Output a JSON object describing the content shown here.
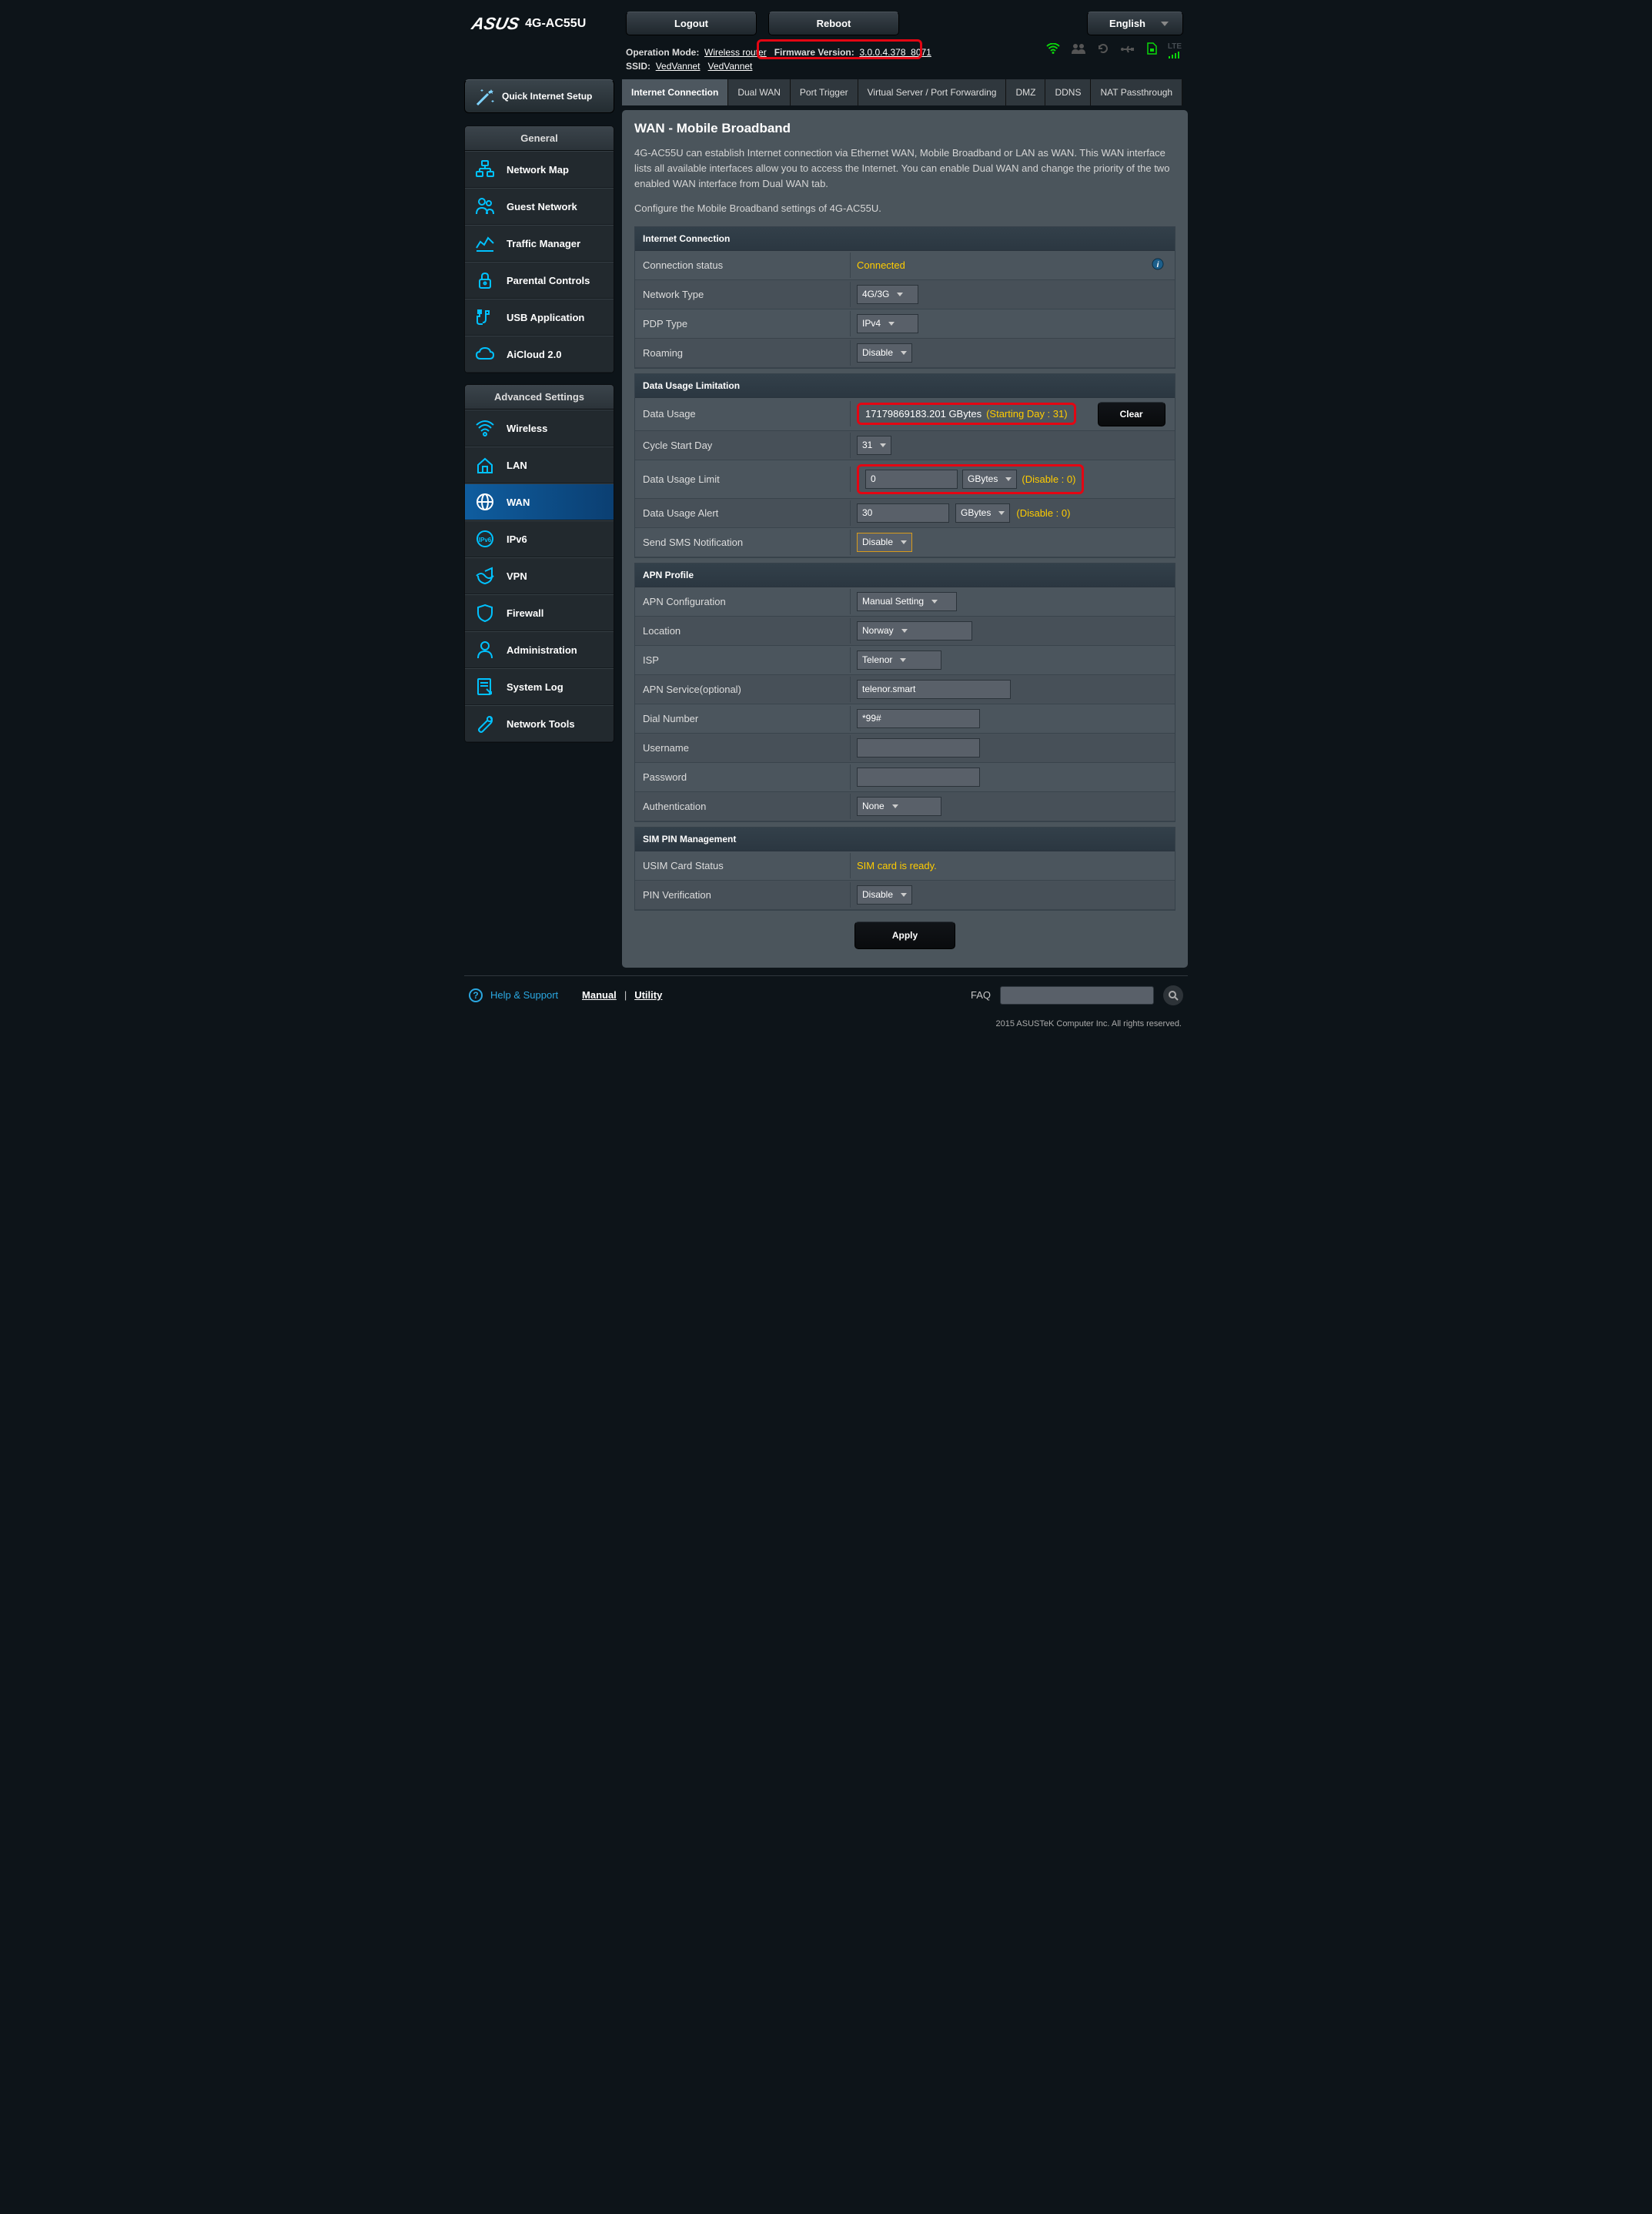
{
  "logo": "ASUS",
  "model": "4G-AC55U",
  "top_buttons": {
    "logout": "Logout",
    "reboot": "Reboot"
  },
  "language": "English",
  "info": {
    "op_mode_label": "Operation Mode:",
    "op_mode_value": "Wireless router",
    "fw_label": "Firmware Version:",
    "fw_value": "3.0.0.4.378_8071",
    "ssid_label": "SSID:",
    "ssid_1": "VedVannet",
    "ssid_2": "VedVannet"
  },
  "sidebar": {
    "qis": "Quick Internet Setup",
    "general_head": "General",
    "general": [
      {
        "label": "Network Map"
      },
      {
        "label": "Guest Network"
      },
      {
        "label": "Traffic Manager"
      },
      {
        "label": "Parental Controls"
      },
      {
        "label": "USB Application"
      },
      {
        "label": "AiCloud 2.0"
      }
    ],
    "adv_head": "Advanced Settings",
    "adv": [
      {
        "label": "Wireless"
      },
      {
        "label": "LAN"
      },
      {
        "label": "WAN",
        "active": true
      },
      {
        "label": "IPv6"
      },
      {
        "label": "VPN"
      },
      {
        "label": "Firewall"
      },
      {
        "label": "Administration"
      },
      {
        "label": "System Log"
      },
      {
        "label": "Network Tools"
      }
    ]
  },
  "tabs": [
    {
      "label": "Internet Connection",
      "active": true
    },
    {
      "label": "Dual WAN"
    },
    {
      "label": "Port Trigger"
    },
    {
      "label": "Virtual Server / Port Forwarding"
    },
    {
      "label": "DMZ"
    },
    {
      "label": "DDNS"
    },
    {
      "label": "NAT Passthrough"
    }
  ],
  "page_title": "WAN - Mobile Broadband",
  "desc1": "4G-AC55U can establish Internet connection via Ethernet WAN, Mobile Broadband or LAN as WAN. This WAN interface lists all available interfaces allow you to access the Internet. You can enable Dual WAN and change the priority of the two enabled WAN interface from Dual WAN tab.",
  "desc2": "Configure the Mobile Broadband settings of 4G-AC55U.",
  "sections": {
    "ic": {
      "head": "Internet Connection",
      "conn_status_lbl": "Connection status",
      "conn_status_val": "Connected",
      "net_type_lbl": "Network Type",
      "net_type_val": "4G/3G",
      "pdp_lbl": "PDP Type",
      "pdp_val": "IPv4",
      "roaming_lbl": "Roaming",
      "roaming_val": "Disable"
    },
    "du": {
      "head": "Data Usage Limitation",
      "usage_lbl": "Data Usage",
      "usage_val": "17179869183.201 GBytes",
      "usage_note": "(Starting Day : 31)",
      "clear": "Clear",
      "cycle_lbl": "Cycle Start Day",
      "cycle_val": "31",
      "limit_lbl": "Data Usage Limit",
      "limit_val": "0",
      "limit_unit": "GBytes",
      "limit_note": "(Disable : 0)",
      "alert_lbl": "Data Usage Alert",
      "alert_val": "30",
      "alert_unit": "GBytes",
      "alert_note": "(Disable : 0)",
      "sms_lbl": "Send SMS Notification",
      "sms_val": "Disable"
    },
    "apn": {
      "head": "APN Profile",
      "cfg_lbl": "APN Configuration",
      "cfg_val": "Manual Setting",
      "loc_lbl": "Location",
      "loc_val": "Norway",
      "isp_lbl": "ISP",
      "isp_val": "Telenor",
      "svc_lbl": "APN Service(optional)",
      "svc_val": "telenor.smart",
      "dial_lbl": "Dial Number",
      "dial_val": "*99#",
      "user_lbl": "Username",
      "user_val": "",
      "pass_lbl": "Password",
      "pass_val": "",
      "auth_lbl": "Authentication",
      "auth_val": "None"
    },
    "sim": {
      "head": "SIM PIN Management",
      "usim_lbl": "USIM Card Status",
      "usim_val": "SIM card is ready.",
      "pin_lbl": "PIN Verification",
      "pin_val": "Disable"
    }
  },
  "apply": "Apply",
  "footer": {
    "help": "Help & Support",
    "manual": "Manual",
    "sep": " | ",
    "utility": "Utility",
    "faq": "FAQ"
  },
  "copyright": "2015 ASUSTeK Computer Inc. All rights reserved."
}
